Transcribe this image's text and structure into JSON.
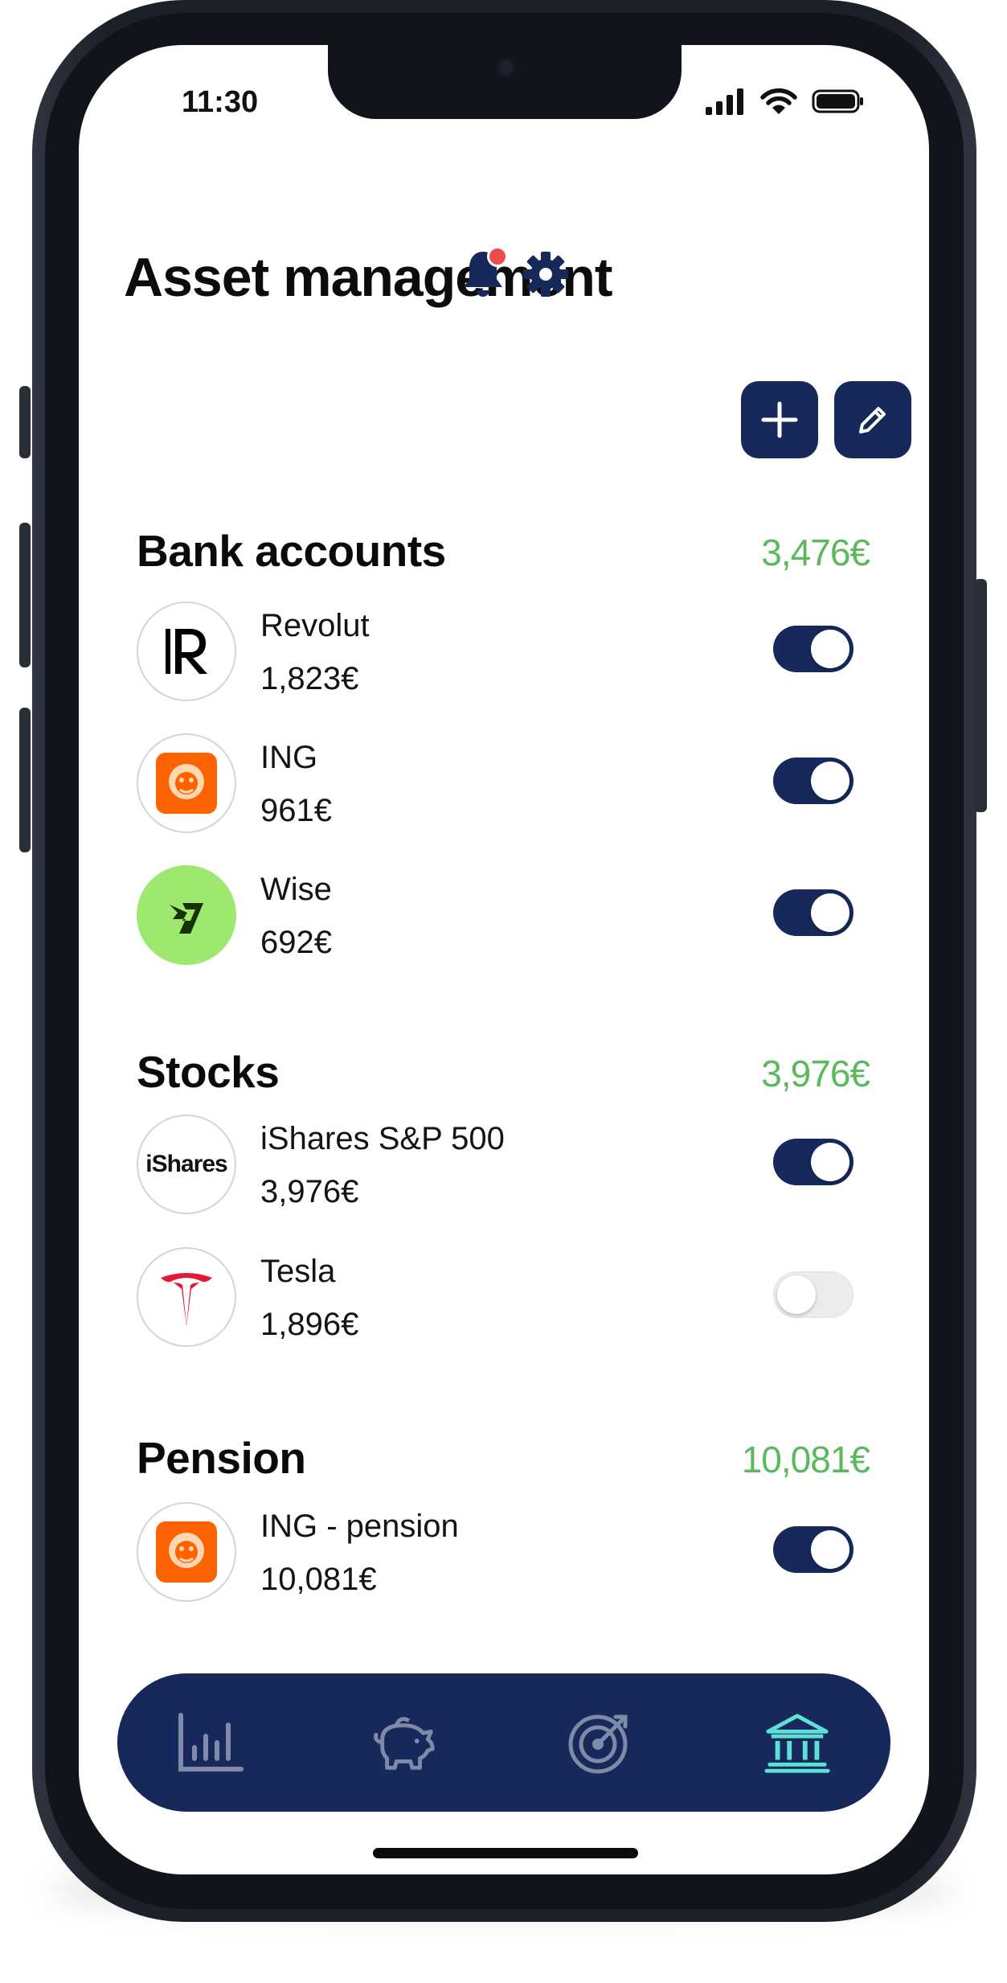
{
  "status_bar": {
    "time": "11:30"
  },
  "header": {
    "title": "Asset management"
  },
  "icons": {
    "notification": "bell-icon",
    "settings": "gear-icon",
    "add": "plus-icon",
    "edit": "pencil-icon"
  },
  "colors": {
    "primary": "#17285a",
    "positive": "#5cb85c",
    "notification_dot": "#ef4b4b",
    "nav_active": "#5ee0d6",
    "nav_inactive": "#7f8aa8"
  },
  "sections": [
    {
      "title": "Bank accounts",
      "total": "3,476€",
      "items": [
        {
          "name": "Revolut",
          "amount": "1,823€",
          "logo": "revolut-logo",
          "enabled": true
        },
        {
          "name": "ING",
          "amount": "961€",
          "logo": "ing-logo",
          "enabled": true
        },
        {
          "name": "Wise",
          "amount": "692€",
          "logo": "wise-logo",
          "enabled": true
        }
      ]
    },
    {
      "title": "Stocks",
      "total": "3,976€",
      "items": [
        {
          "name": "iShares S&P 500",
          "amount": "3,976€",
          "logo": "ishares-logo",
          "logo_text": "iShares",
          "enabled": true
        },
        {
          "name": "Tesla",
          "amount": "1,896€",
          "logo": "tesla-logo",
          "enabled": false
        }
      ]
    },
    {
      "title": "Pension",
      "total": "10,081€",
      "items": [
        {
          "name": "ING - pension",
          "amount": "10,081€",
          "logo": "ing-logo",
          "enabled": true
        }
      ]
    }
  ],
  "bottom_nav": [
    {
      "icon": "bar-chart-icon",
      "active": false
    },
    {
      "icon": "piggy-bank-icon",
      "active": false
    },
    {
      "icon": "target-icon",
      "active": false
    },
    {
      "icon": "bank-icon",
      "active": true
    }
  ]
}
